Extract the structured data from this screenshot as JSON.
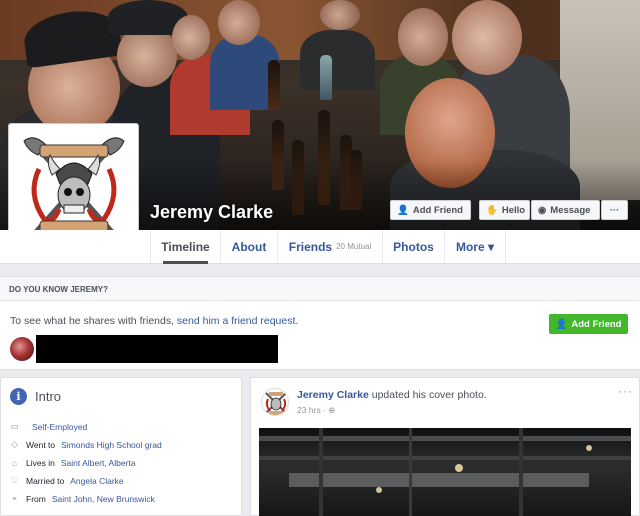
{
  "profile": {
    "name": "Jeremy Clarke",
    "logo_top": "Fortress",
    "logo_bottom": "Guard"
  },
  "cover_buttons": {
    "add_friend": "Add Friend",
    "hello": "Hello",
    "message": "Message",
    "more": "···"
  },
  "tabs": [
    {
      "label": "Timeline"
    },
    {
      "label": "About"
    },
    {
      "label": "Friends",
      "sub": "20 Mutual"
    },
    {
      "label": "Photos"
    },
    {
      "label": "More ▾"
    }
  ],
  "know": {
    "header": "DO YOU KNOW JEREMY?",
    "text": "To see what he shares with friends, ",
    "link": "send him a friend request",
    "period": ".",
    "button": "Add Friend"
  },
  "intro": {
    "title": "Intro",
    "rows": [
      {
        "icon": "briefcase-icon",
        "pre": "",
        "link": "Self-Employed"
      },
      {
        "icon": "graduation-cap-icon",
        "pre": "Went to ",
        "link": "Simonds High School grad"
      },
      {
        "icon": "home-icon",
        "pre": "Lives in ",
        "link": "Saint Albert, Alberta"
      },
      {
        "icon": "heart-icon",
        "pre": "Married to ",
        "link": "Angela Clarke"
      },
      {
        "icon": "location-pin-icon",
        "pre": "From ",
        "link": "Saint John, New Brunswick"
      }
    ]
  },
  "post": {
    "author": "Jeremy Clarke",
    "action": " updated his cover photo.",
    "time": "23 hrs · ",
    "more": "···"
  },
  "colors": {
    "facebook_blue": "#4267b2",
    "link": "#365899",
    "green": "#42b72a"
  }
}
